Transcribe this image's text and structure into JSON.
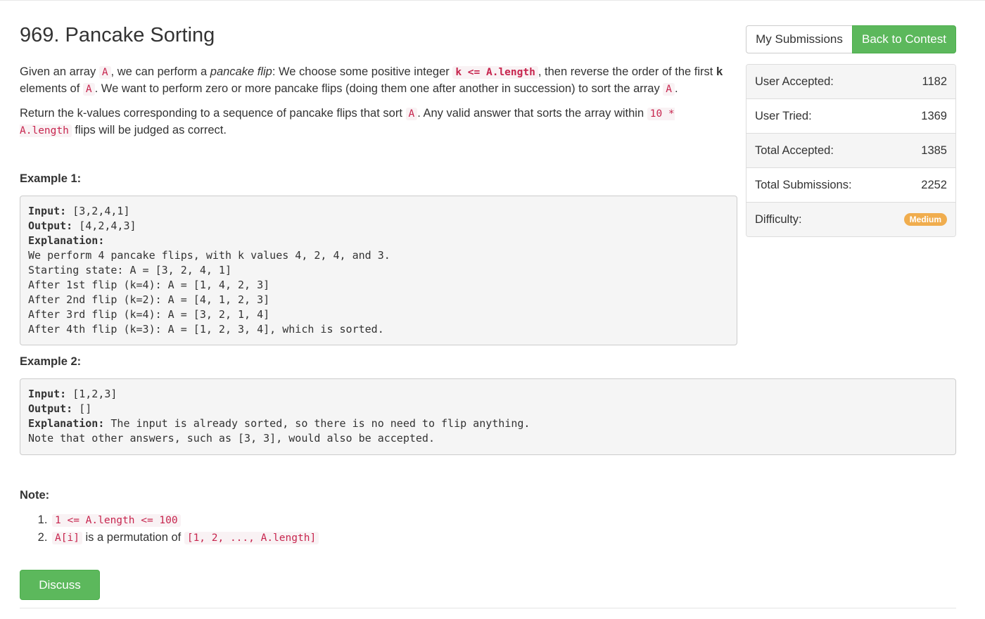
{
  "title": "969. Pancake Sorting",
  "description": {
    "p1_t1": "Given an array ",
    "p1_c1": "A",
    "p1_t2": ", we can perform a ",
    "p1_em": "pancake flip",
    "p1_t3": ": We choose some positive integer ",
    "p1_c2": "k <= A.length",
    "p1_t4": ", then reverse the order of the first ",
    "p1_b": "k",
    "p1_t5": " elements of ",
    "p1_c3": "A",
    "p1_t6": ".  We want to perform zero or more pancake flips (doing them one after another in succession) to sort the array ",
    "p1_c4": "A",
    "p1_t7": ".",
    "p2_t1": "Return the k-values corresponding to a sequence of pancake flips that sort ",
    "p2_c1": "A",
    "p2_t2": ".  Any valid answer that sorts the array within ",
    "p2_c2": "10 * A.length",
    "p2_t3": " flips will be judged as correct."
  },
  "example1": {
    "heading": "Example 1:",
    "input_label": "Input:",
    "input_value": " [3,2,4,1]",
    "output_label": "Output:",
    "output_value": " [4,2,4,3]",
    "explanation_label": "Explanation:",
    "lines": [
      "We perform 4 pancake flips, with k values 4, 2, 4, and 3.",
      "Starting state: A = [3, 2, 4, 1]",
      "After 1st flip (k=4): A = [1, 4, 2, 3]",
      "After 2nd flip (k=2): A = [4, 1, 2, 3]",
      "After 3rd flip (k=4): A = [3, 2, 1, 4]",
      "After 4th flip (k=3): A = [1, 2, 3, 4], which is sorted."
    ]
  },
  "example2": {
    "heading": "Example 2:",
    "input_label": "Input:",
    "input_value": " [1,2,3]",
    "output_label": "Output:",
    "output_value": " []",
    "explanation_label": "Explanation:",
    "explanation_value": " The input is already sorted, so there is no need to flip anything.",
    "line2": "Note that other answers, such as [3, 3], would also be accepted."
  },
  "note": {
    "heading": "Note:",
    "item1_code": "1 <= A.length <= 100",
    "item2_code1": "A[i]",
    "item2_text": " is a permutation of ",
    "item2_code2": "[1, 2, ..., A.length]"
  },
  "buttons": {
    "my_submissions": "My Submissions",
    "back_to_contest": "Back to Contest",
    "discuss": "Discuss"
  },
  "stats": {
    "user_accepted_label": "User Accepted:",
    "user_accepted_value": "1182",
    "user_tried_label": "User Tried:",
    "user_tried_value": "1369",
    "total_accepted_label": "Total Accepted:",
    "total_accepted_value": "1385",
    "total_submissions_label": "Total Submissions:",
    "total_submissions_value": "2252",
    "difficulty_label": "Difficulty:",
    "difficulty_value": "Medium"
  },
  "colors": {
    "success": "#5cb85c",
    "warning": "#f0ad4e",
    "code_text": "#c7254e"
  }
}
